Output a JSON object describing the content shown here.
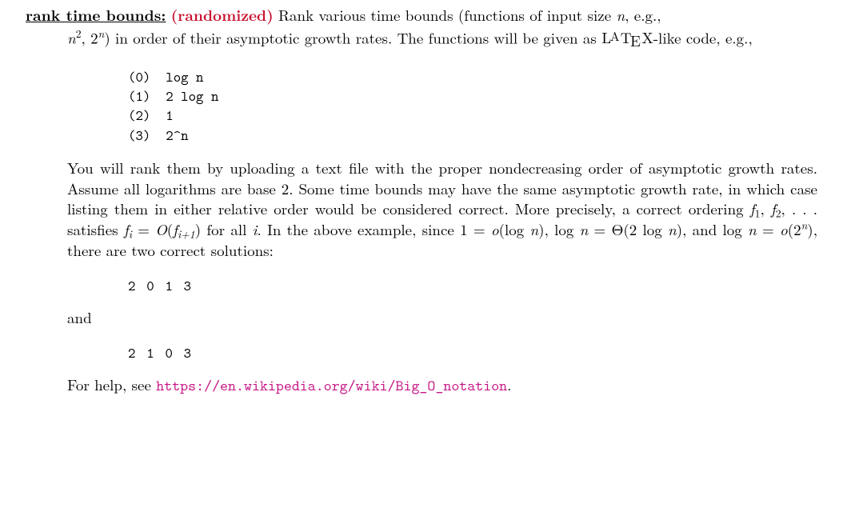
{
  "title": {
    "name_label": "rank time bounds:",
    "tag_label": "(randomized)",
    "intro_before": "Rank various time bounds (functions of input size ",
    "n": "n",
    "intro_mid": ", e.g., ",
    "n2": "n",
    "n2_exp": "2",
    "twon_base": "2",
    "twon_exp": "n",
    "intro_after_examples": ") in order of their asymptotic growth rates.  The functions will be given as ",
    "latex": "LATEX",
    "intro_tail": "-like code, e.g.,"
  },
  "codeblock": {
    "line0": "(0)  log n",
    "line1": "(1)  2 log n",
    "line2": "(2)  1",
    "line3": "(3)  2^n"
  },
  "para2": {
    "s1": "You will rank them by uploading a text file with the proper nondecreasing order of asymptotic growth rates.  Assume all logarithms are base 2.  Some time bounds may have the same asymptotic growth rate, in which case listing them in either relative order would be considered correct.  More precisely, a correct ordering ",
    "f1": "f",
    "sub1": "1",
    "f2": "f",
    "sub2": "2",
    "ellipsis": ", . . . ",
    "s2": " satisfies ",
    "fi": "f",
    "subi": "i",
    "eqO": " = O",
    "lpar": "(",
    "fi1": "f",
    "subi1": "i+1",
    "rpar": ")",
    "s3": " for all ",
    "ivar": "i",
    "s4": ".  In the above example, since 1 = ",
    "smallo1": "o",
    "arg1a": "(log ",
    "arg1n": "n",
    "arg1b": ")",
    "s5": ", log ",
    "n2var": "n",
    "eqTheta": " = Θ(2 log ",
    "n3var": "n",
    "rpar2": ")",
    "s6": ", and log ",
    "n4var": "n",
    "eqo2": " = ",
    "smallo2": "o",
    "lpar3": "(2",
    "expn": "n",
    "rpar3": ")",
    "s7": ", there are two correct solutions:"
  },
  "solution1": "2 0 1 3",
  "and_label": "and",
  "solution2": "2 1 0 3",
  "help": {
    "prefix": "For help, see ",
    "url": "https://en.wikipedia.org/wiki/Big_O_notation",
    "period": "."
  }
}
